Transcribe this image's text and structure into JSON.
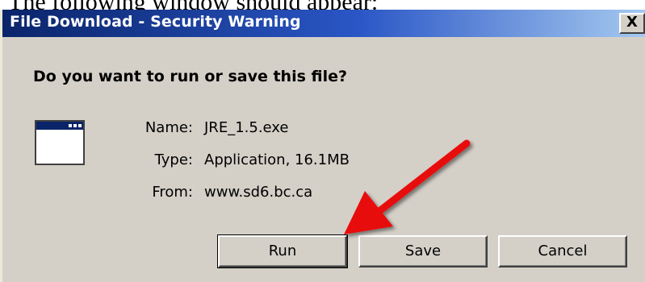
{
  "caption": "The following window should appear:",
  "dialog": {
    "title": "File Download - Security Warning",
    "close_label": "X",
    "question": "Do you want to run or save this file?",
    "file_icon": "application-window-icon",
    "fields": {
      "name_label": "Name:",
      "name_value": "JRE_1.5.exe",
      "type_label": "Type:",
      "type_value": "Application, 16.1MB",
      "from_label": "From:",
      "from_value": "www.sd6.bc.ca"
    },
    "buttons": {
      "run": "Run",
      "save": "Save",
      "cancel": "Cancel"
    }
  },
  "annotation": {
    "icon": "red-arrow-icon",
    "color": "#e81010"
  },
  "colors": {
    "dialog_bg": "#d4d0c8",
    "titlebar_start": "#0a246a",
    "titlebar_end": "#a6caf0",
    "title_text": "#ffffff"
  }
}
